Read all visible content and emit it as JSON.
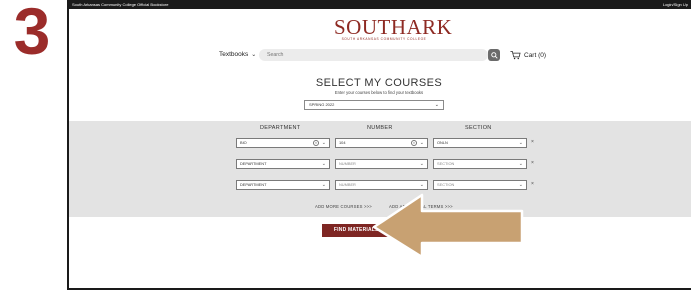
{
  "step_number": "3",
  "topbar": {
    "left_text": "South Arkansas Community College Official Bookstore",
    "right_text": "Login/Sign Up"
  },
  "logo": {
    "main": "SOUTHARK",
    "sub": "SOUTH ARKANSAS COMMUNITY COLLEGE"
  },
  "nav": {
    "textbooks_label": "Textbooks"
  },
  "search": {
    "placeholder": "Search"
  },
  "cart": {
    "label": "Cart (0)"
  },
  "heading": "SELECT MY COURSES",
  "subheading": "Enter your courses below to find your textbooks",
  "term": {
    "selected": "SPRING 2022"
  },
  "columns": {
    "department": "DEPARTMENT",
    "number": "NUMBER",
    "section": "SECTION"
  },
  "rows": [
    {
      "department": "BIO",
      "number": "104",
      "section": "ONLN"
    },
    {
      "department": "DEPARTMENT",
      "number": "NUMBER",
      "section": "SECTION"
    },
    {
      "department": "DEPARTMENT",
      "number": "NUMBER",
      "section": "SECTION"
    }
  ],
  "links": {
    "add_courses": "ADD MORE COURSES >>>",
    "add_terms": "ADD ADDITIONAL TERMS >>>"
  },
  "find_button": {
    "label": "FIND MATERIALS FOR 1 COURSE"
  },
  "colors": {
    "brand": "#8e2a23",
    "button": "#7e2623",
    "arrow": "#c8a172",
    "step_number": "#9b2c2a"
  }
}
